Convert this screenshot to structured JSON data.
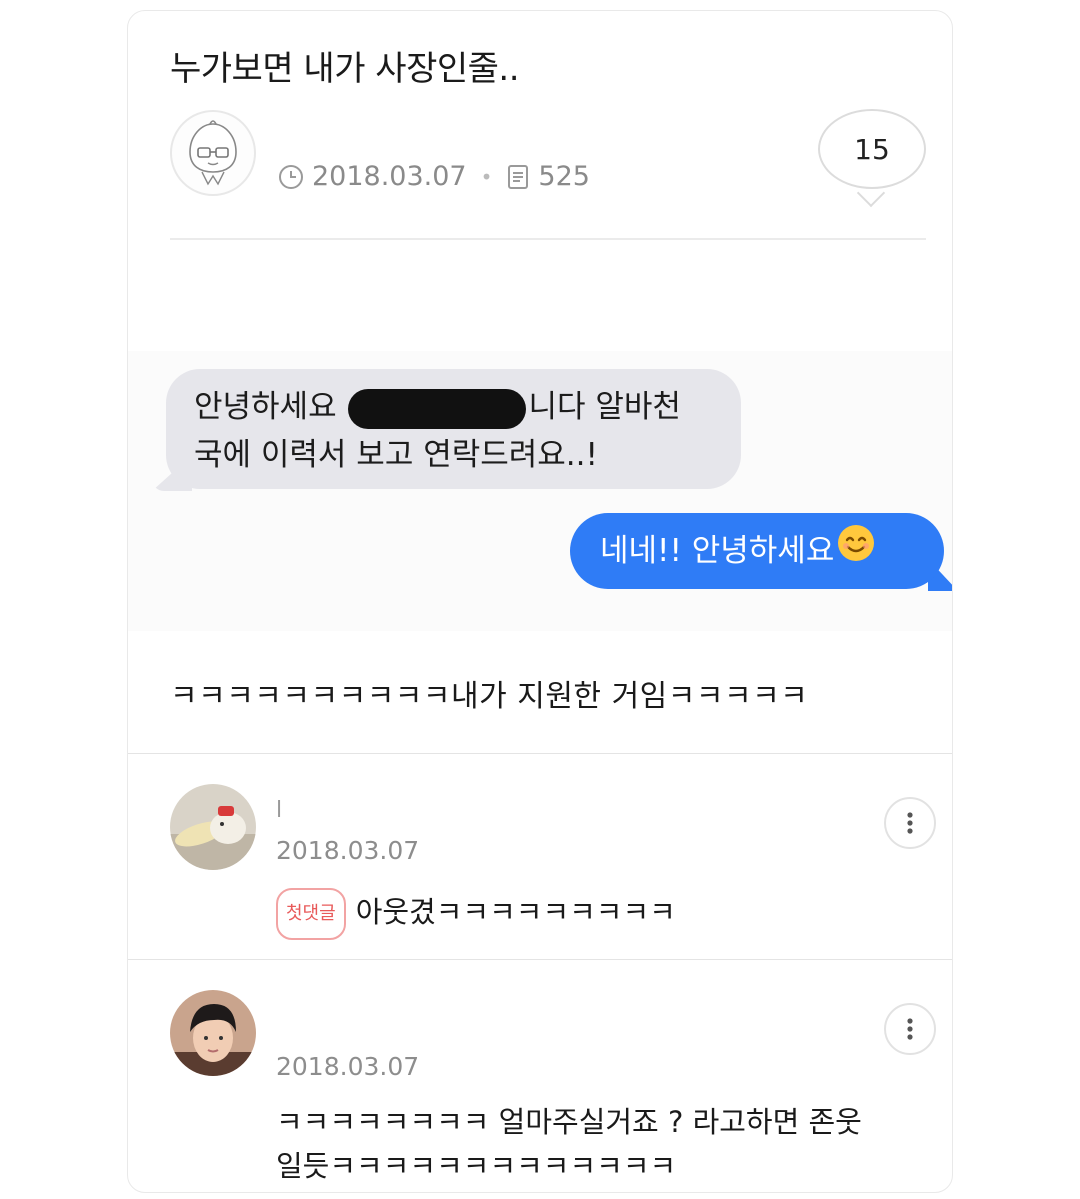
{
  "post": {
    "title": "누가보면 내가 사장인줄..",
    "author_avatar_icon": "character-avatar-icon",
    "date": "2018.03.07",
    "views": "525",
    "comment_count": "15",
    "body": "ㅋㅋㅋㅋㅋㅋㅋㅋㅋㅋ내가 지원한 거임ㅋㅋㅋㅋㅋ"
  },
  "chat": {
    "incoming_part1": "안녕하세요",
    "incoming_part2": "니다 알바천",
    "incoming_line2": "국에 이력서 보고 연락드려요..!",
    "outgoing": "네네!! 안녕하세요",
    "incoming_color": "#e6e6eb",
    "outgoing_color": "#2f7cf6"
  },
  "comments": [
    {
      "name": "l",
      "date": "2018.03.07",
      "badge": "첫댓글",
      "text": "아웃겼ㅋㅋㅋㅋㅋㅋㅋㅋㅋ",
      "avatar_icon": "hamster-photo-avatar"
    },
    {
      "date": "2018.03.07",
      "text_line1": "ㅋㅋㅋㅋㅋㅋㅋㅋ 얼마주실거죠 ? 라고하면 존웃",
      "text_line2": "일듯ㅋㅋㅋㅋㅋㅋㅋㅋㅋㅋㅋㅋㅋ",
      "avatar_icon": "person-photo-avatar"
    }
  ]
}
